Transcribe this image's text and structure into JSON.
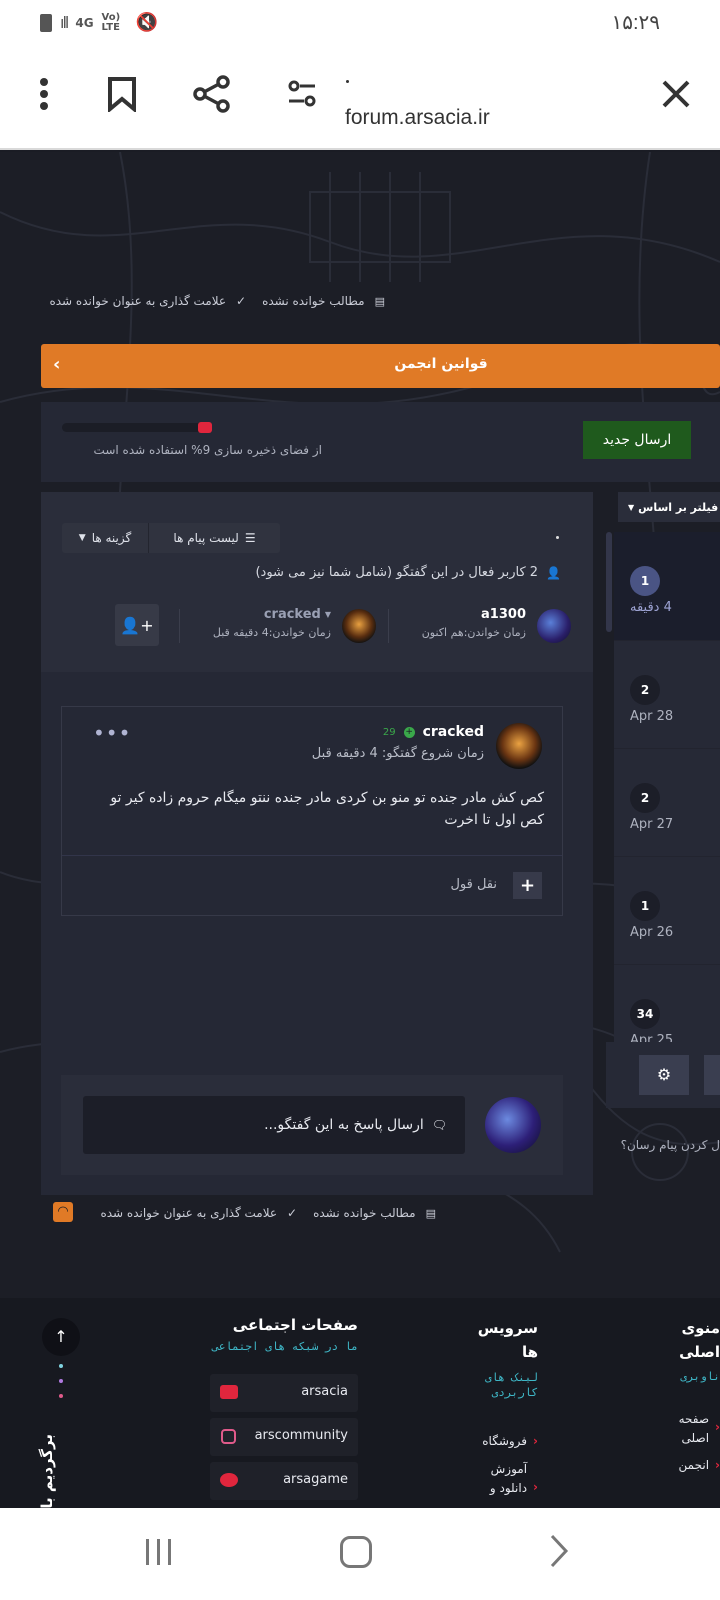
{
  "status_bar": {
    "time": "۱۵:۲۹",
    "network": "4G",
    "volte": "Vo) LTE"
  },
  "browser": {
    "url": "forum.arsacia.ir"
  },
  "toolbar_top": {
    "unread_label": "مطالب خوانده نشده",
    "mark_read_label": "علامت گذاری به عنوان خوانده شده"
  },
  "rules_bar": {
    "label": "قوانین انجمن"
  },
  "storage": {
    "text": "از فضای ذخیره سازی 9% استفاده شده است",
    "percent": 9
  },
  "new_post_button": "ارسال جدید",
  "filter_label": "فیلتر بر اساس",
  "conversation": {
    "options_label": "گزینه ها",
    "messages_list_label": "لیست پیام ها",
    "active_users": "2 کاربر فعال در این گفتگو (شامل شما نیز می شود)",
    "participants": [
      {
        "name": "a1300",
        "seen": "زمان خواندن:هم اکنون"
      },
      {
        "name": "cracked",
        "seen": "زمان خواندن:4 دقیقه قبل"
      }
    ],
    "post": {
      "author": "cracked",
      "rep": "29",
      "started": "زمان شروع گفتگو: 4 دقیقه قبل",
      "body": "کص کش مادر جنده تو منو بن کردی مادر جنده ننتو میگام حروم زاده کیر تو کص اول تا اخرت",
      "quote_label": "نقل قول"
    },
    "reply_placeholder": "ارسال پاسخ به این گفتگو..."
  },
  "side_list": [
    {
      "count": "1",
      "date": "4 دقیقه"
    },
    {
      "count": "2",
      "date": "Apr 28"
    },
    {
      "count": "2",
      "date": "Apr 27"
    },
    {
      "count": "1",
      "date": "Apr 26"
    },
    {
      "count": "34",
      "date": "Apr 25"
    }
  ],
  "messenger_question": "ل کردن پیام رسان؟",
  "toolbar_bottom": {
    "unread_label": "مطالب خوانده نشده",
    "mark_read_label": "علامت گذاری به عنوان خوانده شده"
  },
  "footer": {
    "back_to_top": "برگردیم بالا",
    "social": {
      "title": "صفحات اجتماعی",
      "subtitle": "ما در شبکه های اجتماعی",
      "items": [
        "arsacia",
        "arscommunity",
        "arsagame"
      ]
    },
    "services": {
      "title1": "سرویس",
      "title2": "ها",
      "subtitle": "لینک های کاربردی",
      "items": [
        "فروشگاه",
        "آموزش دانلود و"
      ]
    },
    "menu": {
      "title1": "منوی",
      "title2": "اصلی",
      "subtitle": "ناوبری",
      "items": [
        "صفحه اصلی",
        "انجمن"
      ]
    }
  },
  "colors": {
    "accent": "#e07a26",
    "green": "#1f5a1d",
    "bg": "#1c1e26",
    "card": "#272a36"
  }
}
